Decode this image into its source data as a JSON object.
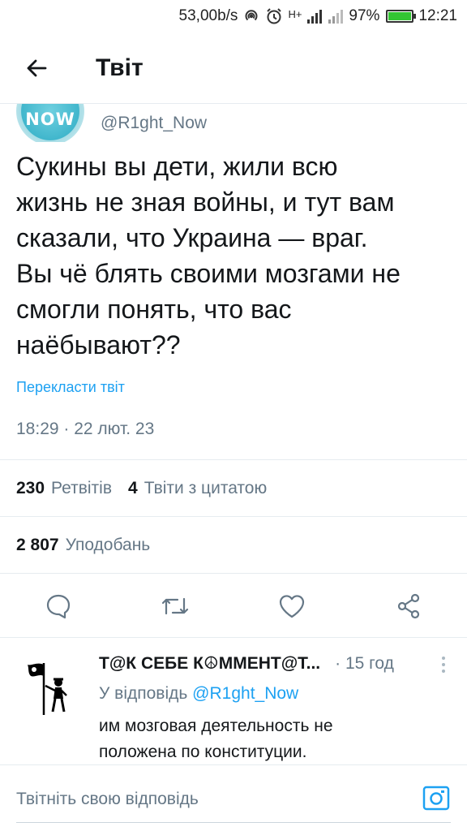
{
  "status_bar": {
    "speed": "53,00b/s",
    "network": "H+",
    "battery_percent_text": "97%",
    "battery_level": 0.97,
    "time": "12:21",
    "icons": [
      "hotspot-icon",
      "alarm-icon",
      "signal-icon",
      "signal-icon",
      "battery-icon"
    ]
  },
  "app_bar": {
    "title": "Твіт",
    "back_icon": "arrow-left-icon"
  },
  "tweet": {
    "avatar_text": "NOW",
    "handle": "@R1ght_Now",
    "text": "Сукины вы дети, жили всю\nжизнь не зная войны, и тут вам\nсказали, что Украина — враг.\nВы чё блять своими мозгами не\nсмогли понять, что вас\nнаёбывают??",
    "translate_link": "Перекласти твіт",
    "timestamp": "18:29 · 22 лют. 23",
    "retweets_count": "230",
    "retweets_label": "Ретвітів",
    "quotes_count": "4",
    "quotes_label": "Твіти з цитатою",
    "likes_count": "2 807",
    "likes_label": "Уподобань"
  },
  "actions": [
    {
      "name": "reply-icon"
    },
    {
      "name": "retweet-icon"
    },
    {
      "name": "like-icon"
    },
    {
      "name": "share-icon"
    }
  ],
  "reply": {
    "author_name": "Т@К СЕБЕ К☮ММЕНТ@Т...",
    "time": "· 15 год",
    "replying_to_label": "У відповідь",
    "replying_to_handle": "@R1ght_Now",
    "text": "им мозговая деятельность не\nположена по конституции."
  },
  "compose": {
    "placeholder": "Твітніть свою відповідь",
    "camera_icon": "camera-icon"
  },
  "colors": {
    "accent": "#1da1f2",
    "text_primary": "#14171a",
    "text_secondary": "#657786",
    "divider": "#e6ecf0"
  }
}
